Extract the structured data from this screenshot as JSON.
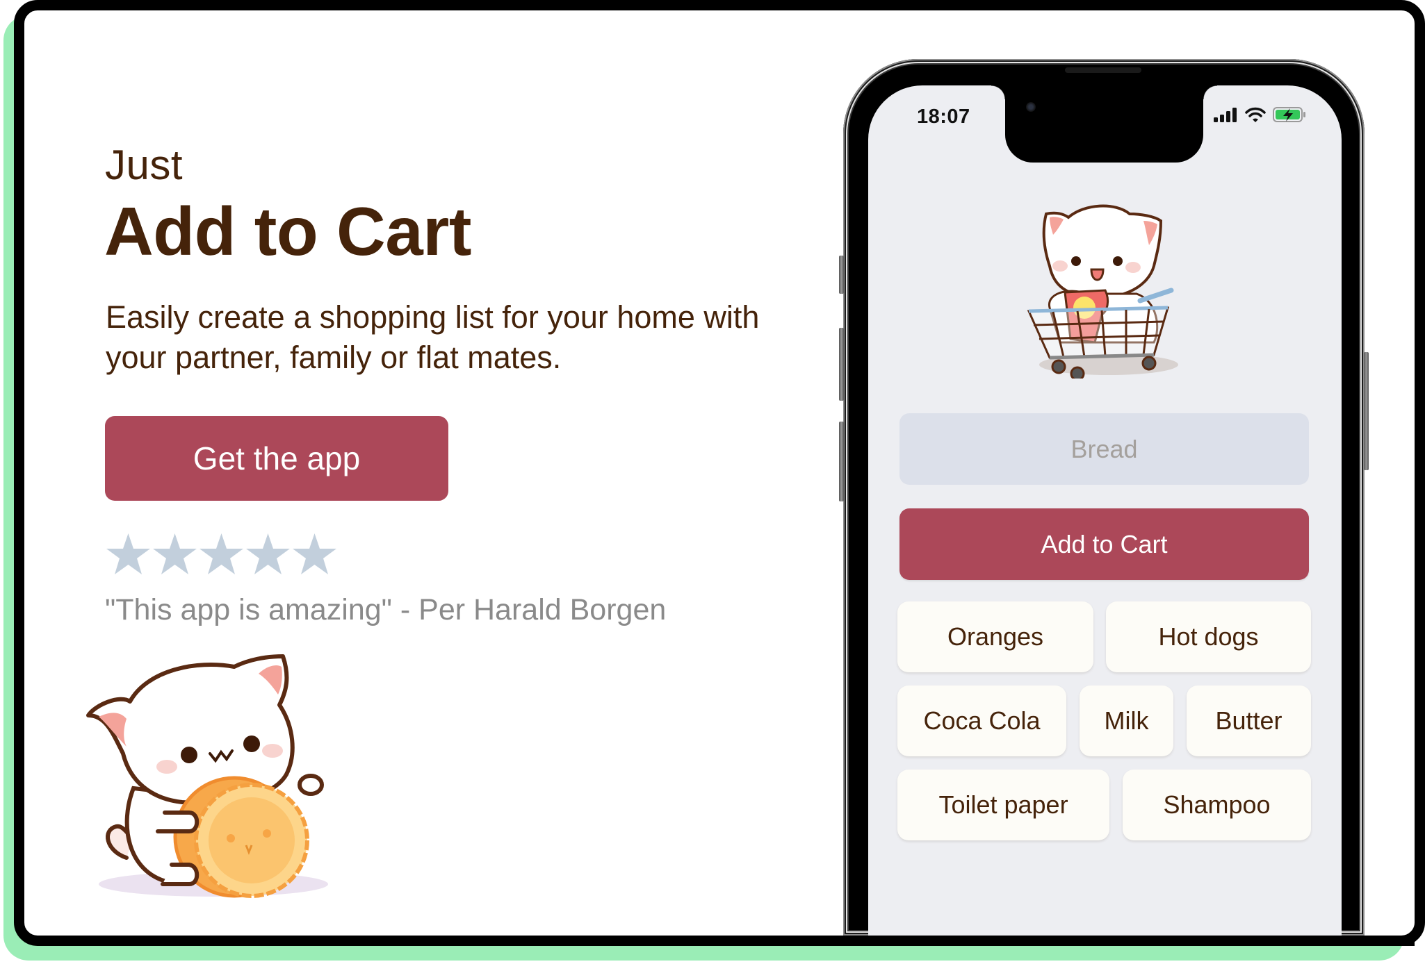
{
  "hero": {
    "kicker": "Just",
    "title": "Add to Cart",
    "description": "Easily create a shopping list for your home with your partner, family or flat mates.",
    "cta_label": "Get the app",
    "rating": {
      "value": 5,
      "max": 5,
      "icon": "star-icon"
    },
    "testimonial": "\"This app is amazing\" - Per Harald Borgen",
    "illustration": "cat-hugging-mooncake"
  },
  "phone": {
    "status_bar": {
      "time": "18:07",
      "icons": [
        "cellular-signal-icon",
        "wifi-icon",
        "battery-charging-icon"
      ]
    },
    "illustration": "cat-in-shopping-cart",
    "input": {
      "value": "",
      "placeholder": "Bread"
    },
    "add_button_label": "Add to Cart",
    "items": [
      [
        "Oranges",
        "Hot dogs"
      ],
      [
        "Coca Cola",
        "Milk",
        "Butter"
      ],
      [
        "Toilet paper",
        "Shampoo"
      ]
    ]
  },
  "colors": {
    "accent": "#AC4859",
    "text_brown": "#45230A",
    "star": "#C2CFDC",
    "quote_gray": "#8A8A8A",
    "screen_bg": "#EDEEF2",
    "input_bg": "#DCE0EA",
    "chip_bg": "#FDFCF7",
    "frame_shadow": "#9AEDB6",
    "battery_green": "#34C759"
  }
}
